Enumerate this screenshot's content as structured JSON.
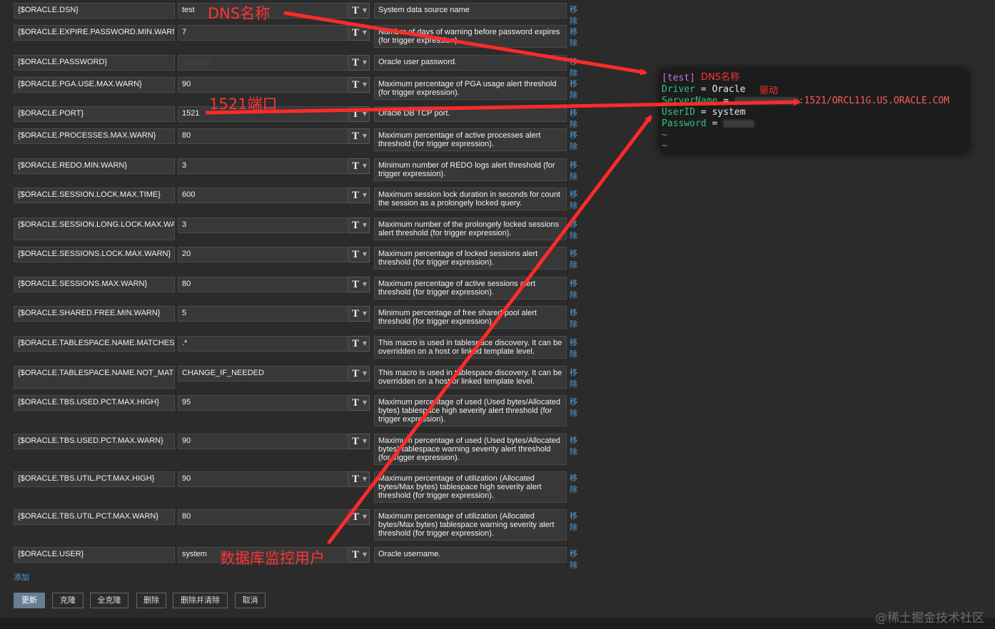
{
  "macros": [
    {
      "macro": "{$ORACLE.DSN}",
      "value": "test",
      "description": "System data source name",
      "remove": "移除"
    },
    {
      "macro": "{$ORACLE.EXPIRE.PASSWORD.MIN.WARN}",
      "value": "7",
      "description": "Number of days of warning before password expires (for trigger expression).",
      "remove": "移除"
    },
    {
      "macro": "{$ORACLE.PASSWORD}",
      "value": "",
      "description": "Oracle user password.",
      "remove": "移除"
    },
    {
      "macro": "{$ORACLE.PGA.USE.MAX.WARN}",
      "value": "90",
      "description": "Maximum percentage of PGA usage alert threshold (for trigger expression).",
      "remove": "移除"
    },
    {
      "macro": "{$ORACLE.PORT}",
      "value": "1521",
      "description": "Oracle DB TCP port.",
      "remove": "移除"
    },
    {
      "macro": "{$ORACLE.PROCESSES.MAX.WARN}",
      "value": "80",
      "description": "Maximum percentage of active processes alert threshold (for trigger expression).",
      "remove": "移除"
    },
    {
      "macro": "{$ORACLE.REDO.MIN.WARN}",
      "value": "3",
      "description": "Minimum number of REDO logs alert threshold (for trigger expression).",
      "remove": "移除"
    },
    {
      "macro": "{$ORACLE.SESSION.LOCK.MAX.TIME}",
      "value": "600",
      "description": "Maximum session lock duration in seconds for count the session as a prolongely locked query.",
      "remove": "移除"
    },
    {
      "macro": "{$ORACLE.SESSION.LONG.LOCK.MAX.WARN}",
      "value": "3",
      "description": "Maximum number of the prolongely locked sessions alert threshold (for trigger expression).",
      "remove": "移除"
    },
    {
      "macro": "{$ORACLE.SESSIONS.LOCK.MAX.WARN}",
      "value": "20",
      "description": "Maximum percentage of locked sessions alert threshold (for trigger expression).",
      "remove": "移除"
    },
    {
      "macro": "{$ORACLE.SESSIONS.MAX.WARN}",
      "value": "80",
      "description": "Maximum percentage of active sessions alert threshold (for trigger expression).",
      "remove": "移除"
    },
    {
      "macro": "{$ORACLE.SHARED.FREE.MIN.WARN}",
      "value": "5",
      "description": "Minimum percentage of free shared pool alert threshold (for trigger expression).",
      "remove": "移除"
    },
    {
      "macro": "{$ORACLE.TABLESPACE.NAME.MATCHES}",
      "value": ".*",
      "description": "This macro is used in tablespace discovery. It can be overridden on a host or linked template level.",
      "remove": "移除"
    },
    {
      "macro": "{$ORACLE.TABLESPACE.NAME.NOT_MATCHES}",
      "value": "CHANGE_IF_NEEDED",
      "description": "This macro is used in tablespace discovery. It can be overridden on a host or linked template level.",
      "remove": "移除"
    },
    {
      "macro": "{$ORACLE.TBS.USED.PCT.MAX.HIGH}",
      "value": "95",
      "description": "Maximum percentage of used (Used bytes/Allocated bytes) tablespace high severity alert threshold (for trigger expression).",
      "remove": "移除"
    },
    {
      "macro": "{$ORACLE.TBS.USED.PCT.MAX.WARN}",
      "value": "90",
      "description": "Maximum percentage of used (Used bytes/Allocated bytes) tablespace warning severity alert threshold (for trigger expression).",
      "remove": "移除"
    },
    {
      "macro": "{$ORACLE.TBS.UTIL.PCT.MAX.HIGH}",
      "value": "90",
      "description": "Maximum percentage of utilization (Allocated bytes/Max bytes) tablespace high severity alert threshold (for trigger expression).",
      "remove": "移除"
    },
    {
      "macro": "{$ORACLE.TBS.UTIL.PCT.MAX.WARN}",
      "value": "80",
      "description": "Maximum percentage of utilization (Allocated bytes/Max bytes) tablespace warning severity alert threshold (for trigger expression).",
      "remove": "移除"
    },
    {
      "macro": "{$ORACLE.USER}",
      "value": "system",
      "description": "Oracle username.",
      "remove": "移除"
    }
  ],
  "type_button_label": "T",
  "add_label": "添加",
  "actions": {
    "update": "更新",
    "clone": "克隆",
    "full_clone": "全克隆",
    "delete": "删除",
    "delete_clear": "删除并清除",
    "cancel": "取消"
  },
  "terminal": {
    "section": "[test]",
    "driver_key": "Driver",
    "driver_value": "Oracle",
    "servername_key": "ServerName",
    "servername_tail": ":1521/ORCL11G.US.ORACLE.COM",
    "userid_key": "UserID",
    "userid_value": "system",
    "password_key": "Password",
    "eq": "=",
    "tilde": "~"
  },
  "annotations": {
    "dns": "DNS名称",
    "dns_terminal": "DNS名称",
    "driver": "驱动",
    "port": "1521端口",
    "user": "数据库监控用户"
  },
  "watermark": "@稀土掘金技术社区",
  "colors": {
    "background": "#2b2b2b",
    "field": "#383838",
    "link": "#4f9fd9",
    "annotation": "#ff3333",
    "primary_button": "#687d94"
  }
}
